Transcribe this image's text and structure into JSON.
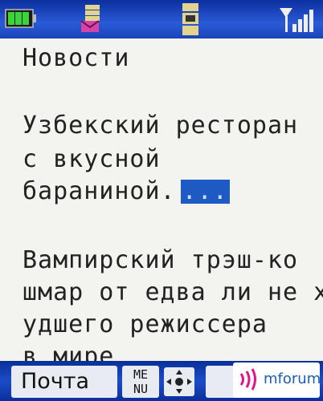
{
  "header": {
    "icons": [
      "battery-icon",
      "message-icon",
      "memory-card-icon",
      "signal-icon"
    ]
  },
  "content": {
    "title": "Новости",
    "items": [
      {
        "lines": [
          "Узбекский ресторан",
          "с вкусной",
          "бараниной."
        ],
        "more_label": "..."
      },
      {
        "lines": [
          "Вампирский трэш-ко",
          "шмар от едва ли не х",
          "удшего режиссера",
          "в мире"
        ]
      }
    ]
  },
  "softkeys": {
    "left_label": "Почта",
    "center_label_top": "ME",
    "center_label_bottom": "NU",
    "right_label": ""
  },
  "watermark": {
    "text": "mforum.ru"
  },
  "colors": {
    "statusbar": "#1a43b8",
    "highlight": "#1e5ac4",
    "background": "#f3f3ef"
  }
}
